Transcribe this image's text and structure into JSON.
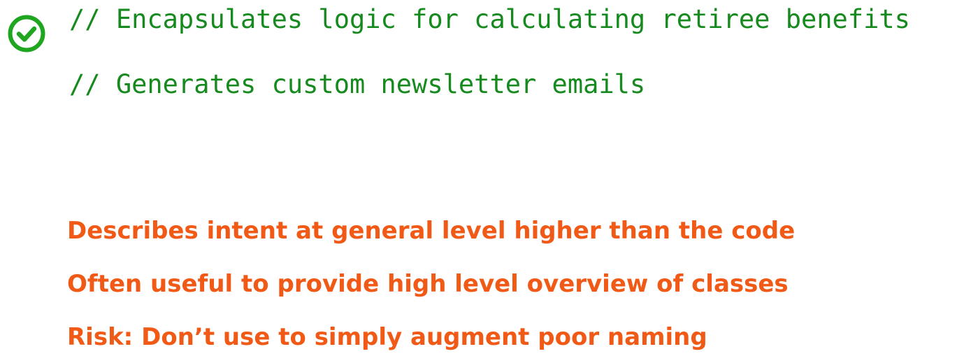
{
  "colors": {
    "code_green": "#168a1e",
    "check_green": "#1fa51f",
    "note_orange": "#f05a16"
  },
  "check_icon": "check-circle-icon",
  "code_comments": [
    "// Encapsulates logic for calculating retiree benefits",
    "// Generates custom newsletter emails"
  ],
  "notes": [
    "Describes intent at general level higher than the code",
    "Often useful to provide high level overview of classes",
    "Risk: Don’t use to simply augment poor naming"
  ]
}
